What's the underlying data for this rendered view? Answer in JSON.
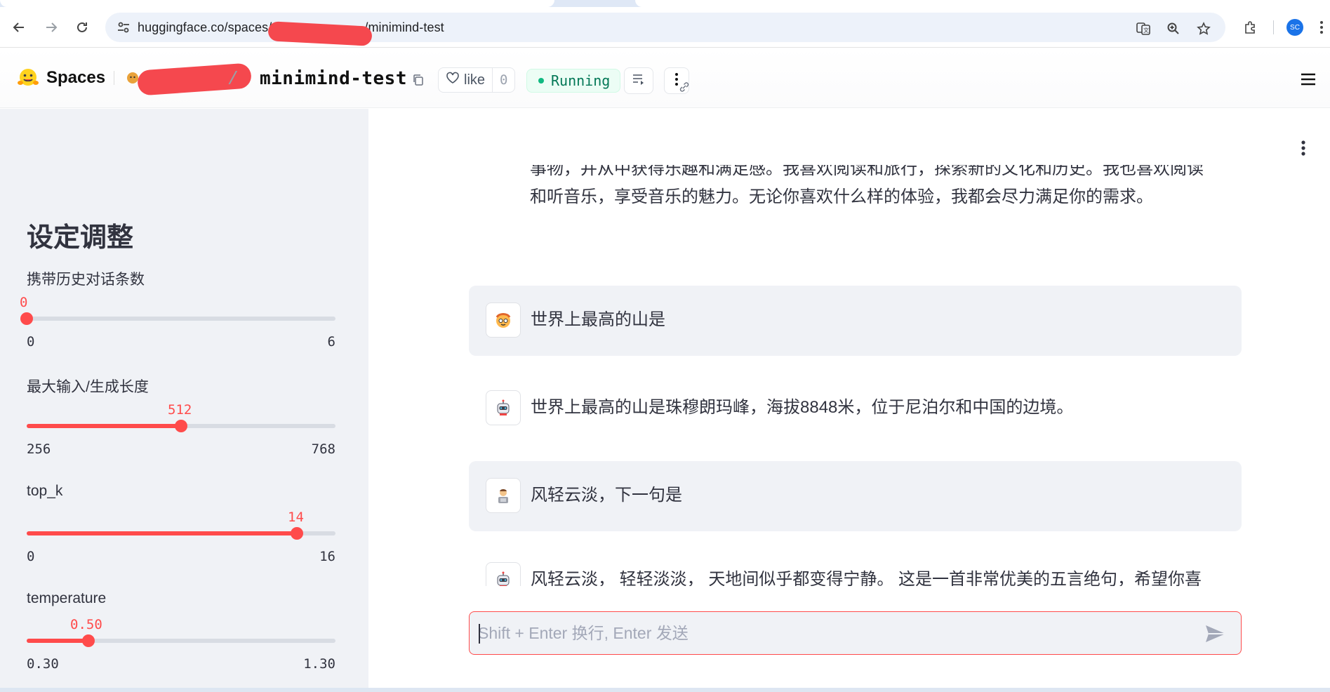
{
  "browser": {
    "url_prefix": "huggingface.co/spaces/",
    "url_suffix": "/minimind-test",
    "profile_initials": "SC"
  },
  "header": {
    "brand": "Spaces",
    "owner_sep": "/",
    "space_name": "minimind-test",
    "like_label": "like",
    "like_count": "0",
    "status": "Running"
  },
  "sidebar": {
    "title": "设定调整",
    "sliders": [
      {
        "label": "携带历史对话条数",
        "value": "0",
        "min": "0",
        "max": "6",
        "fraction": 0.0
      },
      {
        "label": "最大输入/生成长度",
        "value": "512",
        "min": "256",
        "max": "768",
        "fraction": 0.5
      },
      {
        "label": "top_k",
        "value": "14",
        "min": "0",
        "max": "16",
        "fraction": 0.875
      },
      {
        "label": "temperature",
        "value": "0.50",
        "min": "0.30",
        "max": "1.30",
        "fraction": 0.2
      }
    ]
  },
  "chat": {
    "partial_top_line": "事物，并从中获得乐趣和满足感。我喜欢阅读和旅行，探索新的文化和历史。我也喜欢阅读",
    "partial_bottom_line": "和听音乐，享受音乐的魅力。无论你喜欢什么样的体验，我都会尽力满足你的需求。",
    "messages": [
      {
        "role": "user",
        "text": "世界上最高的山是"
      },
      {
        "role": "assistant",
        "text": "世界上最高的山是珠穆朗玛峰，海拔8848米，位于尼泊尔和中国的边境。"
      },
      {
        "role": "user",
        "text": "风轻云淡，下一句是"
      },
      {
        "role": "assistant",
        "text": "风轻云淡， 轻轻淡淡， 天地间似乎都变得宁静。 这是一首非常优美的五言绝句，希望你喜欢。"
      }
    ],
    "input_placeholder": "Shift + Enter 换行, Enter 发送"
  },
  "colors": {
    "accent": "#ff4b4b",
    "sidebar_bg": "#f0f2f6",
    "running": "#10b981"
  }
}
